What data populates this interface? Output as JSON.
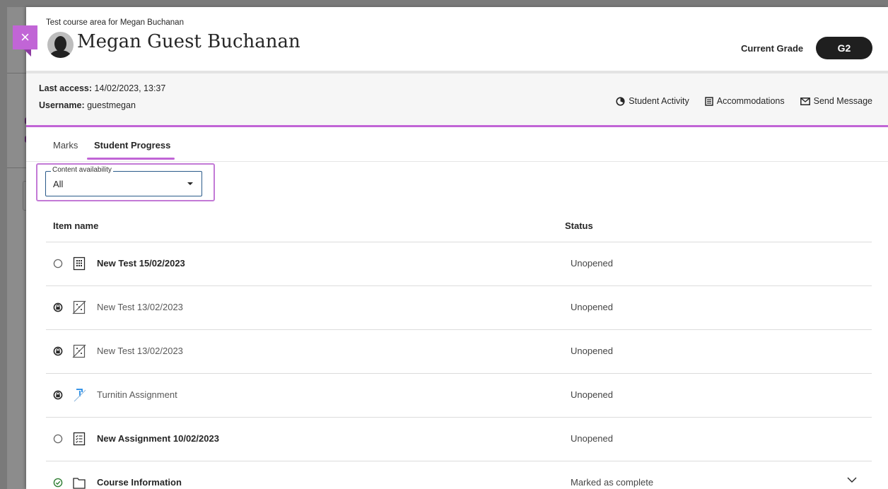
{
  "header": {
    "course_name": "Test course area for Megan Buchanan",
    "student_name": "Megan Guest Buchanan",
    "grade_label": "Current Grade",
    "grade_value": "G2"
  },
  "close_icon": "×",
  "info": {
    "last_access_label": "Last access:",
    "last_access_value": "14/02/2023, 13:37",
    "username_label": "Username:",
    "username_value": "guestmegan"
  },
  "actions": [
    {
      "icon": "activity-icon",
      "label": "Student Activity"
    },
    {
      "icon": "accommodations-icon",
      "label": "Accommodations"
    },
    {
      "icon": "envelope-icon",
      "label": "Send Message"
    }
  ],
  "tabs": [
    "Marks",
    "Student Progress"
  ],
  "active_tab": "Student Progress",
  "filter": {
    "legend": "Content availability",
    "value": "All"
  },
  "table": {
    "col_item": "Item name",
    "col_status": "Status",
    "rows": [
      {
        "status_icon": "empty-circle-icon",
        "type_icon": "test-icon",
        "name": "New Test 15/02/2023",
        "status": "Unopened",
        "bold": true
      },
      {
        "status_icon": "locked-icon",
        "type_icon": "hidden-test-icon",
        "name": "New Test 13/02/2023",
        "status": "Unopened",
        "bold": false
      },
      {
        "status_icon": "locked-icon",
        "type_icon": "hidden-test-icon",
        "name": "New Test 13/02/2023",
        "status": "Unopened",
        "bold": false
      },
      {
        "status_icon": "locked-icon",
        "type_icon": "turnitin-icon",
        "name": "Turnitin Assignment",
        "status": "Unopened",
        "bold": false
      },
      {
        "status_icon": "empty-circle-icon",
        "type_icon": "assignment-icon",
        "name": "New Assignment 10/02/2023",
        "status": "Unopened",
        "bold": true
      },
      {
        "status_icon": "complete-check-icon",
        "type_icon": "folder-icon",
        "name": "Course Information",
        "status": "Marked as complete",
        "bold": true
      }
    ]
  },
  "colors": {
    "accent": "#c165d6",
    "grade_pill": "#1f1f1f",
    "complete_green": "#2e7d32",
    "turnitin_blue": "#1e88e5"
  }
}
